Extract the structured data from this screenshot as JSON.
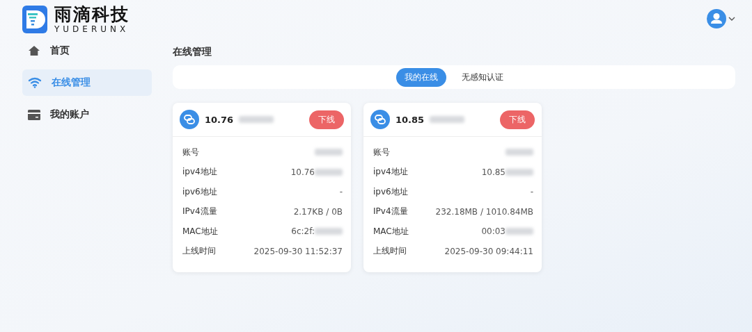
{
  "brand": {
    "name": "雨滴科技",
    "subtitle": "YUDERUNX"
  },
  "sidebar": {
    "items": [
      {
        "label": "首页",
        "selected": false
      },
      {
        "label": "在线管理",
        "selected": true
      },
      {
        "label": "我的账户",
        "selected": false
      }
    ]
  },
  "page_title": "在线管理",
  "tabs": [
    {
      "label": "我的在线",
      "selected": true
    },
    {
      "label": "无感知认证",
      "selected": false
    }
  ],
  "sessions": [
    {
      "title": "10.76",
      "title_redacted": true,
      "button": "下线",
      "fields": [
        {
          "label": "账号",
          "redacted": true
        },
        {
          "label": "ipv4地址",
          "value": "10.76",
          "redacted": true
        },
        {
          "label": "ipv6地址",
          "value": "-",
          "redacted": false
        },
        {
          "label": "IPv4流量",
          "value": "2.17KB / 0B",
          "redacted": false
        },
        {
          "label": "MAC地址",
          "value": "6c:2f:",
          "redacted": true
        },
        {
          "label": "上线时间",
          "value": "2025-09-30 11:52:37",
          "redacted": false
        }
      ]
    },
    {
      "title": "10.85",
      "title_redacted": true,
      "button": "下线",
      "fields": [
        {
          "label": "账号",
          "redacted": true
        },
        {
          "label": "ipv4地址",
          "value": "10.85",
          "redacted": true
        },
        {
          "label": "ipv6地址",
          "value": "-",
          "redacted": false
        },
        {
          "label": "IPv4流量",
          "value": "232.18MB / 1010.84MB",
          "redacted": false
        },
        {
          "label": "MAC地址",
          "value": "00:03",
          "redacted": true
        },
        {
          "label": "上线时间",
          "value": "2025-09-30 09:44:11",
          "redacted": false
        }
      ]
    }
  ]
}
